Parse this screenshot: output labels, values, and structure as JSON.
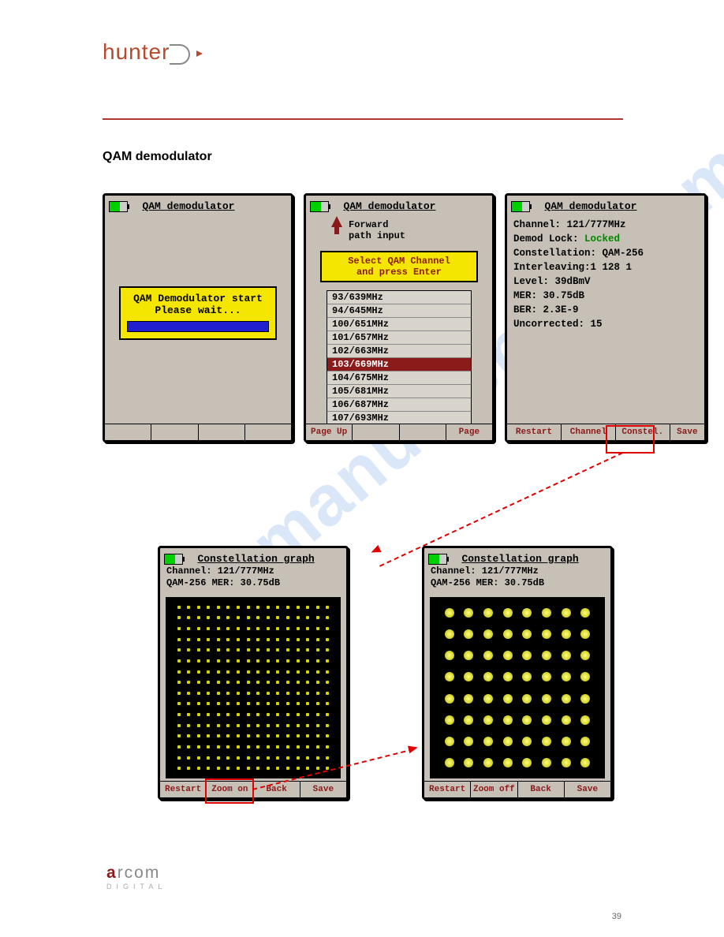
{
  "logo_hunter": "hunter",
  "logo_arcom": {
    "brand": "arcom",
    "sub": "DIGITAL"
  },
  "section_title": "QAM demodulator",
  "watermark": "manualshive.com",
  "page_number": "39",
  "screen1": {
    "title": "QAM demodulator",
    "wait_line1": "QAM Demodulator start",
    "wait_line2": "Please wait..."
  },
  "screen2": {
    "title": "QAM demodulator",
    "forward_l1": "Forward",
    "forward_l2": "path input",
    "select_l1": "Select QAM Channel",
    "select_l2": "and press Enter",
    "channels": [
      "93/639MHz",
      "94/645MHz",
      "100/651MHz",
      "101/657MHz",
      "102/663MHz",
      "103/669MHz",
      "104/675MHz",
      "105/681MHz",
      "106/687MHz",
      "107/693MHz"
    ],
    "selected_index": 5,
    "footer": [
      "Page Up",
      "",
      "",
      "Page Down"
    ]
  },
  "screen3": {
    "title": "QAM demodulator",
    "values": {
      "channel": "Channel: 121/777MHz",
      "demod_lock_label": "Demod Lock: ",
      "demod_lock_value": "Locked",
      "constellation": "Constellation: QAM-256",
      "interleaving": "Interleaving:1 128 1",
      "level": "Level: 39dBmV",
      "mer": "MER: 30.75dB",
      "ber": "BER: 2.3E-9",
      "uncorrected": "Uncorrected: 15"
    },
    "footer": [
      "Restart",
      "Channel",
      "Constel.",
      "Save"
    ]
  },
  "const1": {
    "title": "Constellation graph",
    "line1": "Channel: 121/777MHz",
    "line2": "QAM-256   MER: 30.75dB",
    "footer": [
      "Restart",
      "Zoom on",
      "Back",
      "Save"
    ],
    "grid": 16
  },
  "const2": {
    "title": "Constellation graph",
    "line1": "Channel: 121/777MHz",
    "line2": "QAM-256   MER: 30.75dB",
    "footer": [
      "Restart",
      "Zoom off",
      "Back",
      "Save"
    ],
    "grid": 8
  },
  "chart_data": {
    "type": "scatter",
    "title_left": "Constellation graph (QAM-256, zoom off)",
    "title_right": "Constellation graph (zoom on, 8×8 quadrant)",
    "info": {
      "channel": "121/777MHz",
      "modulation": "QAM-256",
      "mer_db": 30.75
    },
    "left_grid": {
      "rows": 16,
      "cols": 16
    },
    "right_grid": {
      "rows": 8,
      "cols": 8
    }
  }
}
